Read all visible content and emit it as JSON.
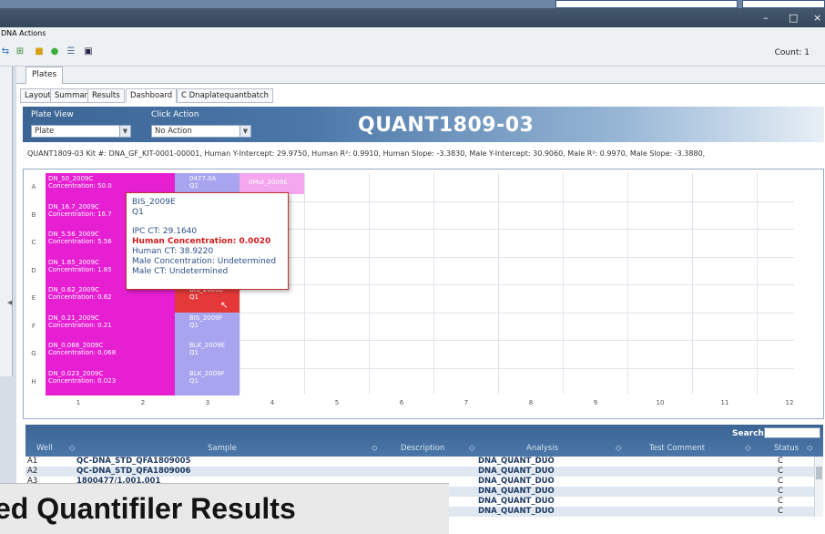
{
  "window": {
    "minimize": "–",
    "maximize": "□",
    "close": "×"
  },
  "menu": {
    "label": "DNA Actions"
  },
  "toolbar": {
    "count_label": "Count:  1",
    "icons": [
      "sync-icon",
      "tree-icon",
      "lock-icon",
      "green-circle-icon",
      "list-icon",
      "image-icon"
    ]
  },
  "tabs": {
    "plates": "Plates",
    "sub": [
      "Layout",
      "Summary",
      "Results",
      "Dashboard",
      "C Dnaplatequantbatch"
    ],
    "active_sub": "Dashboard"
  },
  "header": {
    "plate_view_label": "Plate View",
    "plate_view_value": "Plate",
    "click_action_label": "Click Action",
    "click_action_value": "No Action",
    "title": "QUANT1809-03"
  },
  "kit_line": "QUANT1809-03 Kit #: DNA_GF_KIT-0001-00001, Human Y-Intercept: 29.9750, Human R²: 0.9910, Human Slope: -3.3830, Male Y-Intercept: 30.9060, Male R²: 0.9970, Male Slope: -3.3880,",
  "grid": {
    "rows": [
      "A",
      "B",
      "C",
      "D",
      "E",
      "F",
      "G",
      "H"
    ],
    "cols": [
      "1",
      "2",
      "3",
      "4",
      "5",
      "6",
      "7",
      "8",
      "9",
      "10",
      "11",
      "12"
    ],
    "standards": [
      {
        "name": "DN_50_2009C",
        "conc": "Concentration: 50.0"
      },
      {
        "name": "DN_16.7_2009C",
        "conc": "Concentration: 16.7"
      },
      {
        "name": "DN_5.56_2009C",
        "conc": "Concentration: 5.56"
      },
      {
        "name": "DN_1.85_2009C",
        "conc": "Concentration: 1.85"
      },
      {
        "name": "DN_0.62_2009C",
        "conc": "Concentration: 0.62"
      },
      {
        "name": "DN_0.21_2009C",
        "conc": "Concentration: 0.21"
      },
      {
        "name": "DN_0.068_2009C",
        "conc": "Concentration: 0.068"
      },
      {
        "name": "DN_0.023_2009C",
        "conc": "Concentration: 0.023"
      }
    ],
    "col3": [
      {
        "name": "0477.0A",
        "sub": "Q1"
      },
      {
        "name": "",
        "sub": ""
      },
      {
        "name": "",
        "sub": ""
      },
      {
        "name": "",
        "sub": ""
      },
      {
        "name": "BIS_2009E",
        "sub": "Q1"
      },
      {
        "name": "BIS_2009F",
        "sub": "Q1"
      },
      {
        "name": "BLK_2009E",
        "sub": "Q1"
      },
      {
        "name": "BLK_2009F",
        "sub": "Q1"
      }
    ],
    "a4": "0Mul_2009E",
    "colors": {
      "standard": "#e61fd2",
      "sample": "#a8a4ef",
      "selected": "#e53939",
      "a4": "#f4a6ee"
    }
  },
  "tooltip": {
    "title": "BIS_2009E",
    "sub": "Q1",
    "ipc_ct": "IPC CT: 29.1640",
    "human_conc": "Human Concentration: 0.0020",
    "human_ct": "Human CT: 38.9220",
    "male_conc": "Male Concentration: Undetermined",
    "male_ct": "Male CT: Undetermined"
  },
  "table": {
    "search_label": "Search:",
    "columns": [
      "Well",
      "Sample",
      "Description",
      "Analysis",
      "Test Comment",
      "Status"
    ],
    "rows": [
      {
        "well": "A1",
        "sample": "QC-DNA_STD_QFA1809005",
        "analysis": "DNA_QUANT_DUO",
        "status": "C"
      },
      {
        "well": "A2",
        "sample": "QC-DNA_STD_QFA1809006",
        "analysis": "DNA_QUANT_DUO",
        "status": "C"
      },
      {
        "well": "A3",
        "sample": "1800477/1.001.001",
        "analysis": "DNA_QUANT_DUO",
        "status": "C"
      },
      {
        "well": "",
        "sample": "",
        "analysis": "DNA_QUANT_DUO",
        "status": "C"
      },
      {
        "well": "",
        "sample": "",
        "analysis": "DNA_QUANT_DUO",
        "status": "C"
      },
      {
        "well": "",
        "sample": "",
        "analysis": "DNA_QUANT_DUO",
        "status": "C"
      }
    ]
  },
  "overlay": {
    "text": "ed Quantifiler Results"
  }
}
